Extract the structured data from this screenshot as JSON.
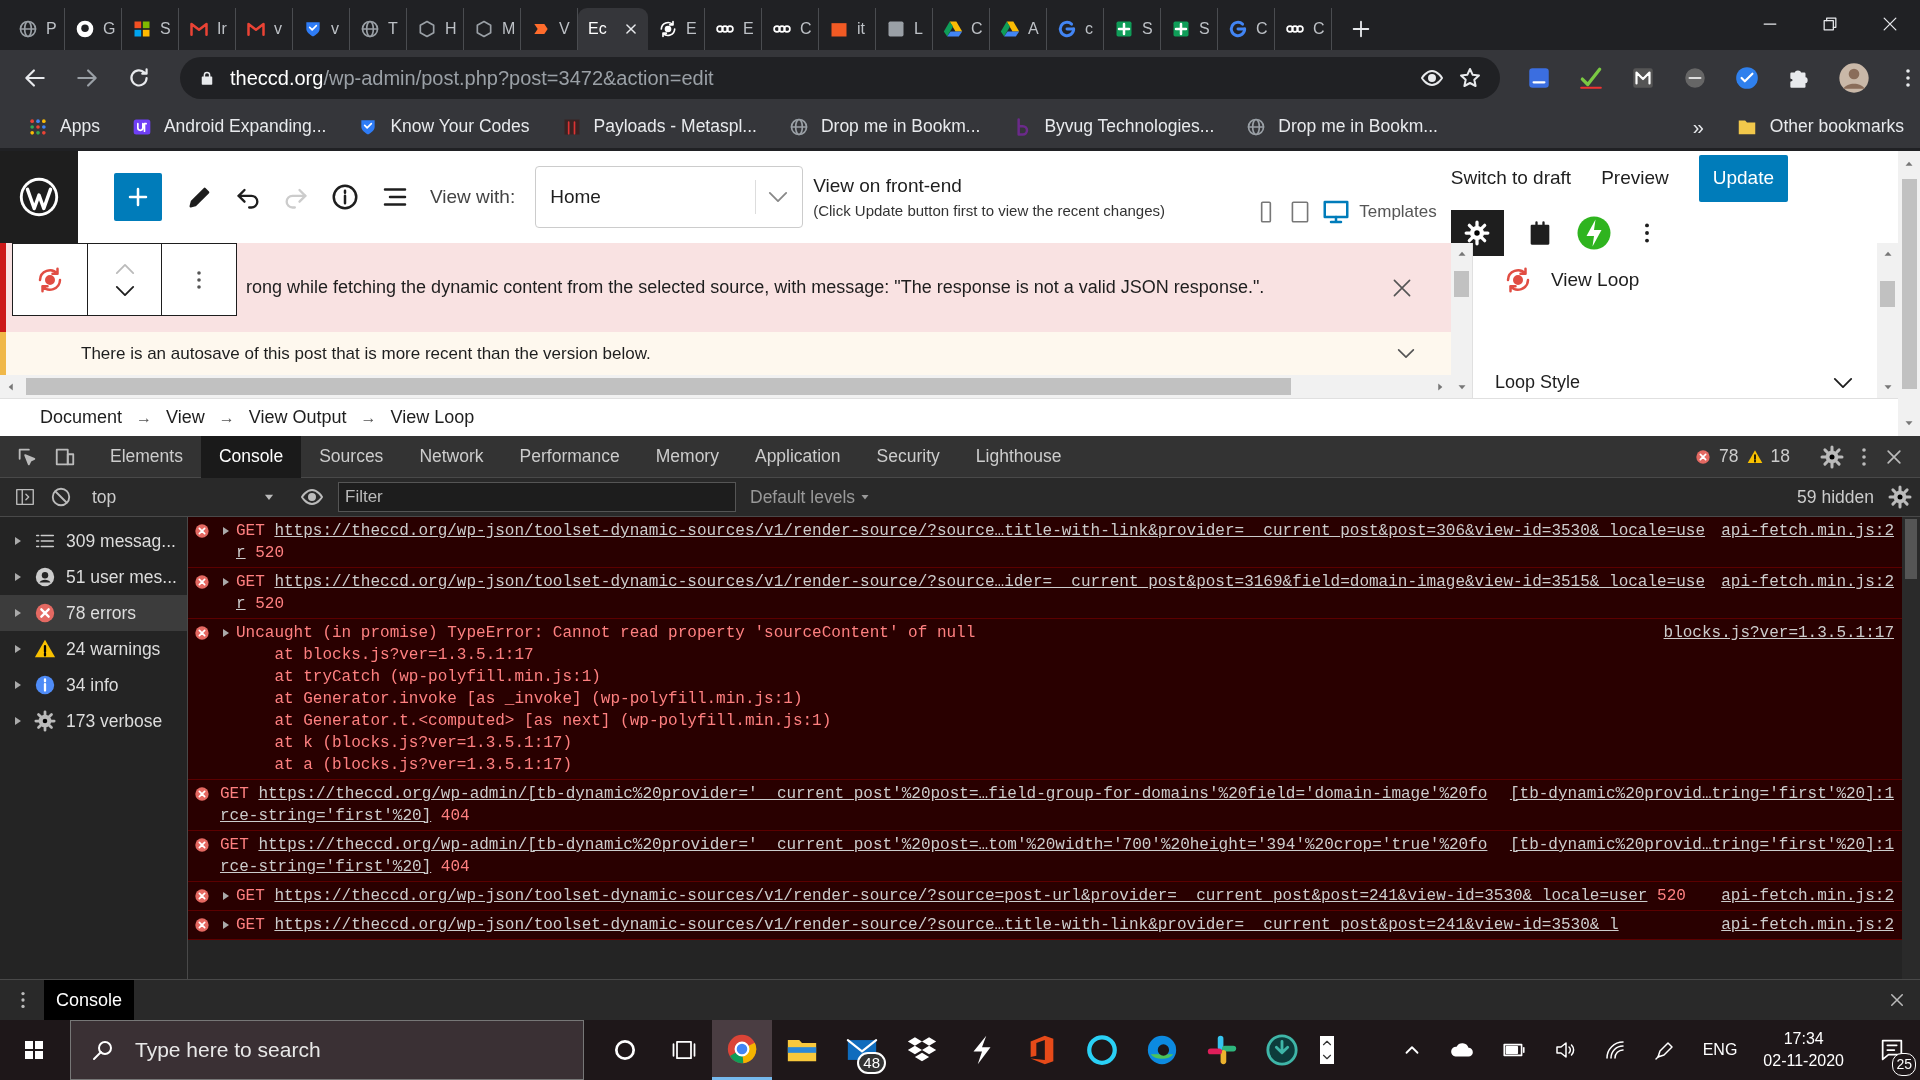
{
  "browser": {
    "tabs": [
      {
        "kind": "globe",
        "label": "P",
        "selected": false
      },
      {
        "kind": "github",
        "label": "G",
        "selected": false
      },
      {
        "kind": "squares",
        "label": "S",
        "selected": false
      },
      {
        "kind": "gmail",
        "label": "Ir",
        "selected": false
      },
      {
        "kind": "gmail",
        "label": "v",
        "selected": false
      },
      {
        "kind": "shield",
        "label": "v",
        "selected": false
      },
      {
        "kind": "globe",
        "label": "T",
        "selected": false
      },
      {
        "kind": "hex",
        "label": "H",
        "selected": false
      },
      {
        "kind": "hex",
        "label": "M",
        "selected": false
      },
      {
        "kind": "cp",
        "label": "V",
        "selected": false
      },
      {
        "kind": "none",
        "label": "Ec",
        "selected": true
      },
      {
        "kind": "loop",
        "label": "E",
        "selected": false
      },
      {
        "kind": "toolset",
        "label": "E",
        "selected": false
      },
      {
        "kind": "toolset",
        "label": "C",
        "selected": false
      },
      {
        "kind": "block",
        "label": "it",
        "selected": false
      },
      {
        "kind": "tile",
        "label": "L",
        "selected": false
      },
      {
        "kind": "drive",
        "label": "C",
        "selected": false
      },
      {
        "kind": "drive",
        "label": "A",
        "selected": false
      },
      {
        "kind": "google",
        "label": "c",
        "selected": false
      },
      {
        "kind": "sheet",
        "label": "S",
        "selected": false
      },
      {
        "kind": "sheet",
        "label": "S",
        "selected": false
      },
      {
        "kind": "google",
        "label": "C",
        "selected": false
      },
      {
        "kind": "toolset",
        "label": "C",
        "selected": false
      }
    ],
    "address": {
      "host": "theccd.org",
      "path": "/wp-admin/post.php?post=3472&action=edit"
    },
    "bookmarks": [
      {
        "kind": "apps",
        "label": "Apps"
      },
      {
        "kind": "up",
        "label": "Android Expanding..."
      },
      {
        "kind": "shield",
        "label": "Know Your Codes"
      },
      {
        "kind": "dark",
        "label": "Payloads - Metaspl..."
      },
      {
        "kind": "globe",
        "label": "Drop me in Bookm..."
      },
      {
        "kind": "b",
        "label": "Byvug Technologies..."
      },
      {
        "kind": "globe",
        "label": "Drop me in Bookm..."
      }
    ],
    "bookmarks_overflow": "»",
    "other_bookmarks": "Other bookmarks"
  },
  "editor": {
    "undo": {
      "disabled": false
    },
    "redo": {
      "disabled": true
    },
    "view_with_label": "View with:",
    "view_with_value": "Home",
    "front_end_link": "View on front-end",
    "front_end_note": "(Click Update button first to view the recent changes)",
    "templates": "Templates",
    "switch_to_draft": "Switch to draft",
    "preview": "Preview",
    "update": "Update",
    "notices": [
      {
        "kind": "error",
        "text": "rong while fetching the dynamic content from the selected source, with message: \"The response is not a valid JSON response.\"."
      },
      {
        "kind": "warning",
        "text": "There is an autosave of this post that is more recent than the version below."
      }
    ],
    "sidebar": {
      "block_title": "View Loop",
      "panel": "Loop Style"
    },
    "breadcrumb": [
      {
        "kind": "crumb",
        "text": "Document"
      },
      {
        "kind": "arrow",
        "text": "→"
      },
      {
        "kind": "crumb",
        "text": "View"
      },
      {
        "kind": "arrow",
        "text": "→"
      },
      {
        "kind": "crumb",
        "text": "View Output"
      },
      {
        "kind": "arrow",
        "text": "→"
      },
      {
        "kind": "crumb",
        "text": "View Loop"
      }
    ]
  },
  "devtools": {
    "tabs": [
      {
        "label": "Elements",
        "selected": false
      },
      {
        "label": "Console",
        "selected": true
      },
      {
        "label": "Sources",
        "selected": false
      },
      {
        "label": "Network",
        "selected": false
      },
      {
        "label": "Performance",
        "selected": false
      },
      {
        "label": "Memory",
        "selected": false
      },
      {
        "label": "Application",
        "selected": false
      },
      {
        "label": "Security",
        "selected": false
      },
      {
        "label": "Lighthouse",
        "selected": false
      }
    ],
    "error_count": "78",
    "warning_count": "18",
    "context": "top",
    "filter_placeholder": "Filter",
    "levels": "Default levels",
    "hidden": "59 hidden",
    "sidebar": [
      {
        "kind": "messages",
        "label": "309 messag...",
        "selected": false
      },
      {
        "kind": "user",
        "label": "51 user mes...",
        "selected": false
      },
      {
        "kind": "errors",
        "label": "78 errors",
        "selected": true
      },
      {
        "kind": "warnings",
        "label": "24 warnings",
        "selected": false
      },
      {
        "kind": "info",
        "label": "34 info",
        "selected": false
      },
      {
        "kind": "verbose",
        "label": "173 verbose",
        "selected": false
      }
    ],
    "messages": [
      {
        "kind": "request",
        "expandable": true,
        "method": "GET",
        "url": "https://theccd.org/wp-json/toolset-dynamic-sources/v1/render-source/?source…title-with-link&provider=__current_post&post=306&view-id=3530&_locale=user",
        "status": "520",
        "source": "api-fetch.min.js:2"
      },
      {
        "kind": "request",
        "expandable": true,
        "method": "GET",
        "url": "https://theccd.org/wp-json/toolset-dynamic-sources/v1/render-source/?source…ider=__current_post&post=3169&field=domain-image&view-id=3515&_locale=user",
        "status": "520",
        "source": "api-fetch.min.js:2"
      },
      {
        "kind": "exception",
        "text": "Uncaught (in promise) TypeError: Cannot read property 'sourceContent' of null",
        "source": "blocks.js?ver=1.3.5.1:17",
        "frames": [
          {
            "before": "at ",
            "link": "blocks.js?ver=1.3.5.1:17"
          },
          {
            "before": "at tryCatch (",
            "link": "wp-polyfill.min.js:1",
            "after": ")"
          },
          {
            "before": "at Generator.invoke [as _invoke] (",
            "link": "wp-polyfill.min.js:1",
            "after": ")"
          },
          {
            "before": "at Generator.t.<computed> [as next] (",
            "link": "wp-polyfill.min.js:1",
            "after": ")"
          },
          {
            "before": "at k (",
            "link": "blocks.js?ver=1.3.5.1:17",
            "after": ")"
          },
          {
            "before": "at a (",
            "link": "blocks.js?ver=1.3.5.1:17",
            "after": ")"
          }
        ]
      },
      {
        "kind": "request",
        "expandable": false,
        "method": "GET",
        "url": "https://theccd.org/wp-admin/[tb-dynamic%20provider='__current_post'%20post=…field-group-for-domains'%20field='domain-image'%20force-string='first'%20]",
        "status": "404",
        "source": "[tb-dynamic%20provid…tring='first'%20]:1"
      },
      {
        "kind": "request",
        "expandable": false,
        "method": "GET",
        "url": "https://theccd.org/wp-admin/[tb-dynamic%20provider='__current_post'%20post=…tom'%20width='700'%20height='394'%20crop='true'%20force-string='first'%20]",
        "status": "404",
        "source": "[tb-dynamic%20provid…tring='first'%20]:1"
      },
      {
        "kind": "request",
        "expandable": true,
        "method": "GET",
        "url": "https://theccd.org/wp-json/toolset-dynamic-sources/v1/render-source/?source=post-url&provider=__current_post&post=241&view-id=3530&_locale=user",
        "status": "520",
        "source": "api-fetch.min.js:2"
      },
      {
        "kind": "request",
        "expandable": true,
        "method": "GET",
        "url": "https://theccd.org/wp-json/toolset-dynamic-sources/v1/render-source/?source…title-with-link&provider=__current_post&post=241&view-id=3530&_l",
        "source": "api-fetch.min.js:2"
      }
    ],
    "drawer_tab": "Console"
  },
  "taskbar": {
    "search_placeholder": "Type here to search",
    "apps": [
      {
        "kind": "chrome",
        "active": true
      },
      {
        "kind": "folder",
        "active": false
      },
      {
        "kind": "mail",
        "active": false,
        "badge": "48"
      },
      {
        "kind": "dropbox",
        "active": false
      },
      {
        "kind": "bolt",
        "active": false
      },
      {
        "kind": "office",
        "active": false
      },
      {
        "kind": "ring",
        "active": false
      },
      {
        "kind": "edge",
        "active": false
      },
      {
        "kind": "slack",
        "active": false
      },
      {
        "kind": "dark",
        "active": false
      }
    ],
    "language": "ENG",
    "time": "17:34",
    "date": "02-11-2020",
    "notifications": "25"
  }
}
